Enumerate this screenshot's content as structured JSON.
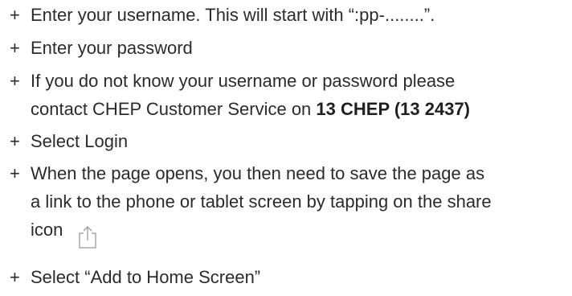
{
  "bullet": "+",
  "items": [
    {
      "text": "Enter your username. This will start with “:pp-........”."
    },
    {
      "text": "Enter your password"
    },
    {
      "line1": "If you do not know your username or password please",
      "line2_prefix": "contact CHEP Customer Service on ",
      "line2_bold": "13 CHEP (13 2437)"
    },
    {
      "text": "Select Login"
    },
    {
      "line1": "When the page opens, you then need to save the page as",
      "line2": "a link to the phone or tablet screen by tapping on the share",
      "line3": "icon",
      "icon": "share-icon"
    },
    {
      "text": "Select “Add to Home Screen”"
    }
  ]
}
